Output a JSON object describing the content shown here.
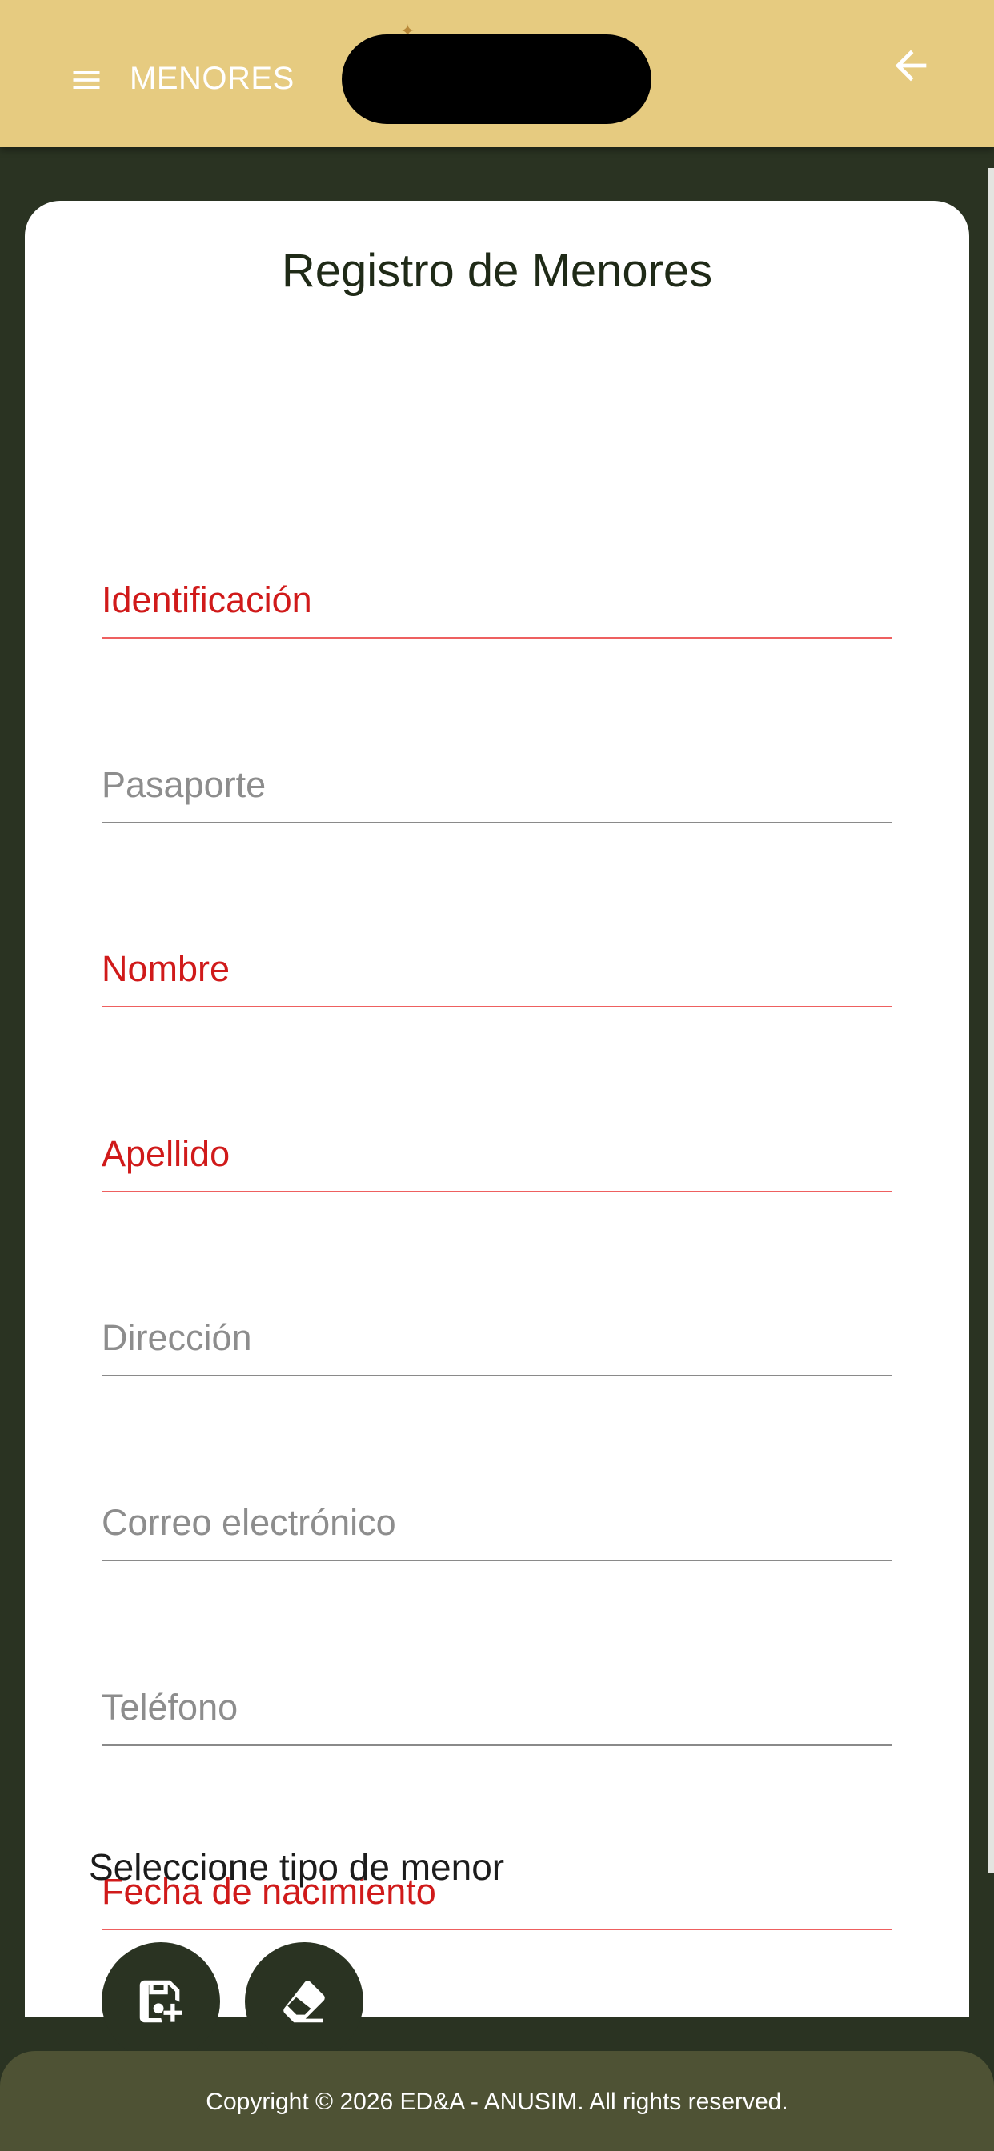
{
  "appbar": {
    "title": "MENORES",
    "menu_icon": "hamburger-menu-icon",
    "back_icon": "arrow-back-icon"
  },
  "form": {
    "title": "Registro de Menores",
    "fields": [
      {
        "label": "Identificación",
        "value": "",
        "required": true
      },
      {
        "label": "Pasaporte",
        "value": "",
        "required": false
      },
      {
        "label": "Nombre",
        "value": "",
        "required": true
      },
      {
        "label": "Apellido",
        "value": "",
        "required": true
      },
      {
        "label": "Dirección",
        "value": "",
        "required": false
      },
      {
        "label": "Correo electrónico",
        "value": "",
        "required": false
      },
      {
        "label": "Teléfono",
        "value": "",
        "required": false
      },
      {
        "label": "Fecha de nacimiento",
        "value": "",
        "required": true
      }
    ],
    "select_label": "Seleccione tipo de menor",
    "actions": [
      {
        "icon": "save-add-icon"
      },
      {
        "icon": "eraser-icon"
      }
    ]
  },
  "footer": {
    "copyright": "Copyright © 2026 ED&A - ANUSIM. All rights reserved."
  },
  "colors": {
    "appbar": "#e6cb80",
    "background": "#2a3322",
    "error": "#d01a1a",
    "footer": "#4e5234"
  }
}
